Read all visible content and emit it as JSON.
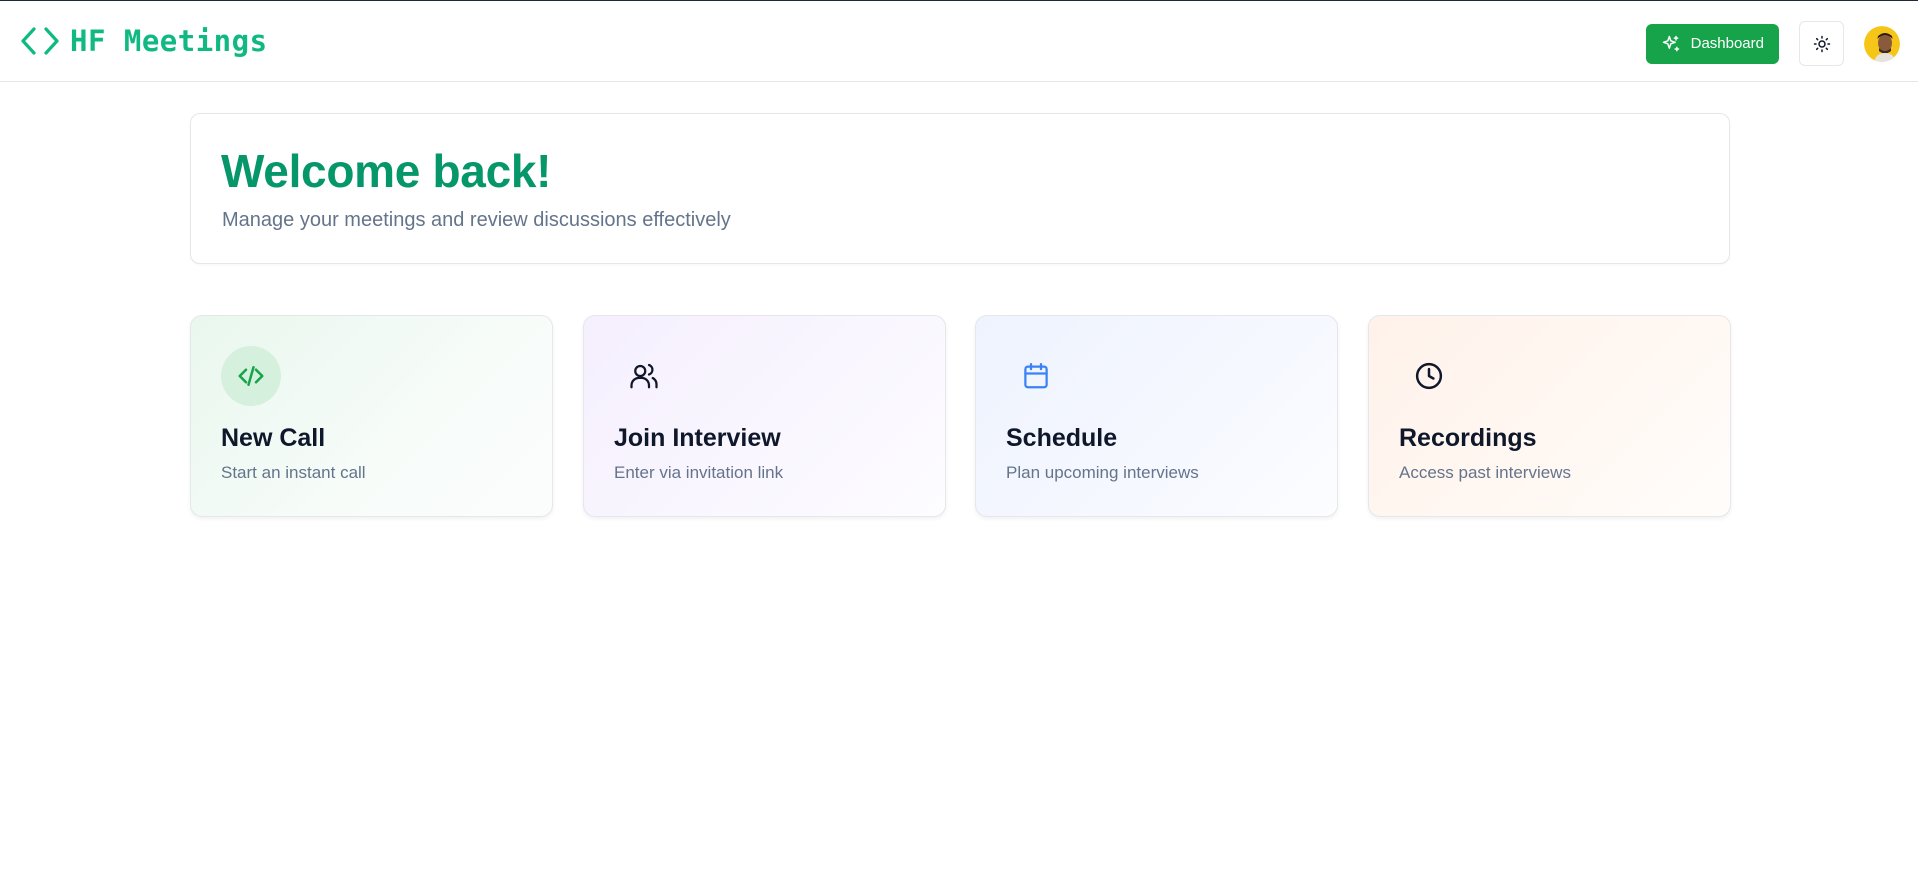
{
  "header": {
    "brand": "HF Meetings",
    "dashboard_label": "Dashboard"
  },
  "colors": {
    "brand": "#10b981",
    "accent": "#16a34a",
    "heading": "#059669"
  },
  "welcome": {
    "title": "Welcome back!",
    "subtitle": "Manage your meetings and review discussions effectively"
  },
  "cards": [
    {
      "title": "New Call",
      "description": "Start an instant call",
      "icon": "code-icon"
    },
    {
      "title": "Join Interview",
      "description": "Enter via invitation link",
      "icon": "users-icon"
    },
    {
      "title": "Schedule",
      "description": "Plan upcoming interviews",
      "icon": "calendar-icon"
    },
    {
      "title": "Recordings",
      "description": "Access past interviews",
      "icon": "clock-icon"
    }
  ]
}
